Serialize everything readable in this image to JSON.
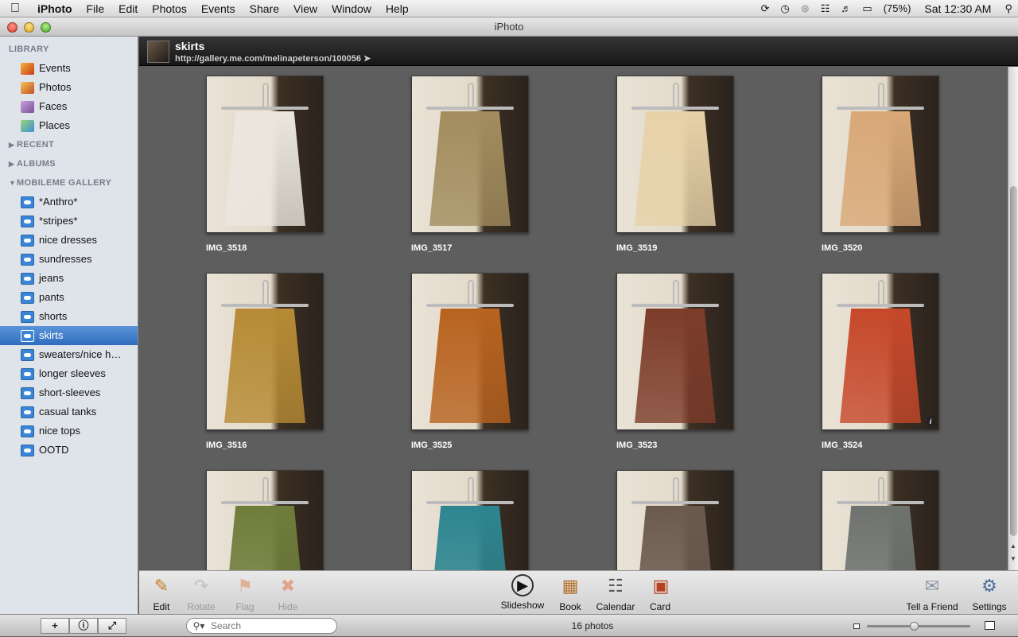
{
  "menubar": {
    "app": "iPhoto",
    "items": [
      "File",
      "Edit",
      "Photos",
      "Events",
      "Share",
      "View",
      "Window",
      "Help"
    ],
    "battery": "(75%)",
    "clock": "Sat 12:30 AM"
  },
  "window": {
    "title": "iPhoto"
  },
  "sidebar": {
    "library_title": "LIBRARY",
    "library": [
      {
        "label": "Events",
        "icon": "events-icon"
      },
      {
        "label": "Photos",
        "icon": "photos-icon"
      },
      {
        "label": "Faces",
        "icon": "faces-icon"
      },
      {
        "label": "Places",
        "icon": "places-icon"
      }
    ],
    "recent_title": "RECENT",
    "albums_title": "ALBUMS",
    "gallery_title": "MOBILEME GALLERY",
    "gallery": [
      {
        "label": "*Anthro*"
      },
      {
        "label": "*stripes*"
      },
      {
        "label": "nice dresses"
      },
      {
        "label": "sundresses"
      },
      {
        "label": "jeans"
      },
      {
        "label": "pants"
      },
      {
        "label": "shorts"
      },
      {
        "label": "skirts",
        "selected": true
      },
      {
        "label": "sweaters/nice h…"
      },
      {
        "label": "longer sleeves"
      },
      {
        "label": "short-sleeves"
      },
      {
        "label": "casual tanks"
      },
      {
        "label": "nice tops"
      },
      {
        "label": "OOTD"
      }
    ]
  },
  "header": {
    "title": "skirts",
    "url": "http://gallery.me.com/melinapeterson/100056"
  },
  "photos": [
    {
      "name": "IMG_3518",
      "color": "#ebe7df"
    },
    {
      "name": "IMG_3517",
      "color": "#a38d5e"
    },
    {
      "name": "IMG_3519",
      "color": "#e7d2a8"
    },
    {
      "name": "IMG_3520",
      "color": "#d9a877"
    },
    {
      "name": "IMG_3516",
      "color": "#b78b35"
    },
    {
      "name": "IMG_3525",
      "color": "#b8631f"
    },
    {
      "name": "IMG_3523",
      "color": "#7d3c2a"
    },
    {
      "name": "IMG_3524",
      "color": "#c6482a",
      "info": "i"
    },
    {
      "name": "",
      "color": "#6f7d3b"
    },
    {
      "name": "",
      "color": "#2d8590"
    },
    {
      "name": "",
      "color": "#6b5a4f"
    },
    {
      "name": "",
      "color": "#6f7370"
    }
  ],
  "toolbar": {
    "edit": "Edit",
    "rotate": "Rotate",
    "flag": "Flag",
    "hide": "Hide",
    "slideshow": "Slideshow",
    "book": "Book",
    "calendar": "Calendar",
    "card": "Card",
    "tell_friend": "Tell a Friend",
    "settings": "Settings"
  },
  "bottombar": {
    "search_placeholder": "Search",
    "photo_count": "16 photos",
    "zoom_level": 0.45
  }
}
